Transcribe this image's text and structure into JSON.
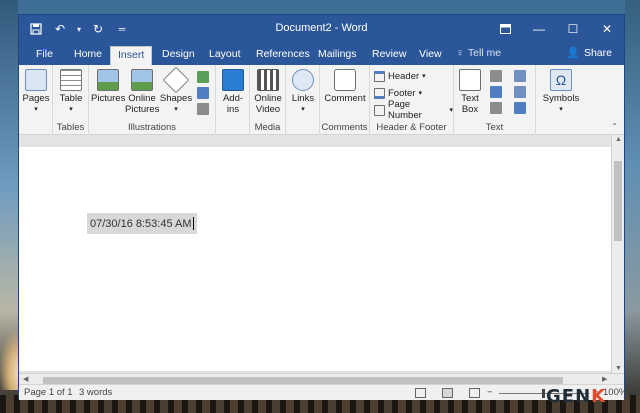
{
  "titlebar": {
    "title": "Document2 - Word",
    "qat": [
      "save-icon",
      "undo-icon",
      "redo-icon",
      "customize-icon"
    ],
    "controls": [
      "ribbon-display-icon",
      "minimize-icon",
      "maximize-icon",
      "close-icon"
    ]
  },
  "tabs": [
    {
      "label": "File"
    },
    {
      "label": "Home"
    },
    {
      "label": "Insert",
      "active": true
    },
    {
      "label": "Design"
    },
    {
      "label": "Layout"
    },
    {
      "label": "References"
    },
    {
      "label": "Mailings"
    },
    {
      "label": "Review"
    },
    {
      "label": "View"
    }
  ],
  "tellme": "Tell me",
  "share": "Share",
  "ribbon": {
    "pages": {
      "btn": "Pages",
      "group": ""
    },
    "tables": {
      "btn": "Table",
      "group": "Tables"
    },
    "illustrations": {
      "pictures": "Pictures",
      "online1": "Online",
      "online2": "Pictures",
      "shapes": "Shapes",
      "group": "Illustrations"
    },
    "addins": {
      "b1": "Add-",
      "b2": "ins"
    },
    "media": {
      "b1": "Online",
      "b2": "Video",
      "group": "Media"
    },
    "links": {
      "btn": "Links"
    },
    "comments": {
      "btn": "Comment",
      "group": "Comments"
    },
    "headerfooter": {
      "header": "Header",
      "footer": "Footer",
      "pagenum": "Page Number",
      "group": "Header & Footer"
    },
    "text": {
      "b1": "Text",
      "b2": "Box",
      "group": "Text"
    },
    "symbols": {
      "btn": "Symbols"
    }
  },
  "document": {
    "field_text": "07/30/16 8:53:45 AM"
  },
  "status": {
    "page": "Page 1 of 1",
    "words": "3 words",
    "zoom": "100%"
  },
  "watermark": {
    "a": "GEN",
    "b": "K"
  },
  "colors": {
    "accent": "#2b579a"
  }
}
